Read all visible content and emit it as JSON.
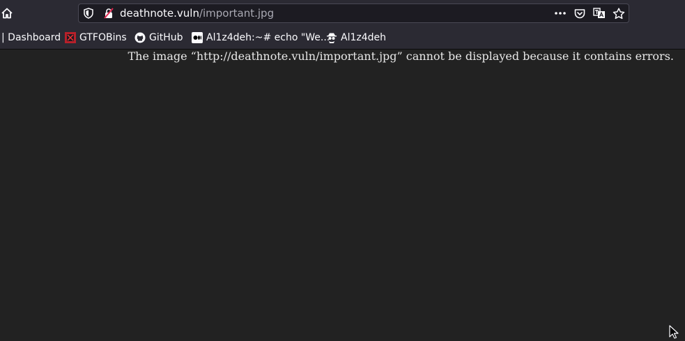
{
  "urlbar": {
    "host": "deathnote.vuln",
    "path": "/important.jpg"
  },
  "bookmarks": [
    {
      "label": "| Dashboard"
    },
    {
      "label": "GTFOBins",
      "icon": "gtfobins-favicon"
    },
    {
      "label": "GitHub",
      "icon": "github-icon"
    },
    {
      "label": "Al1z4deh:~# echo \"We...",
      "icon": "medium-icon"
    },
    {
      "label": "Al1z4deh",
      "icon": "spy-avatar-icon"
    }
  ],
  "content": {
    "error_message": "The image “http://deathnote.vuln/important.jpg” cannot be displayed because it contains errors."
  },
  "colors": {
    "toolbar": "#2b2a33",
    "urlbar": "#1c1b22",
    "page_background": "#222222",
    "text": "#fbfbfe"
  }
}
